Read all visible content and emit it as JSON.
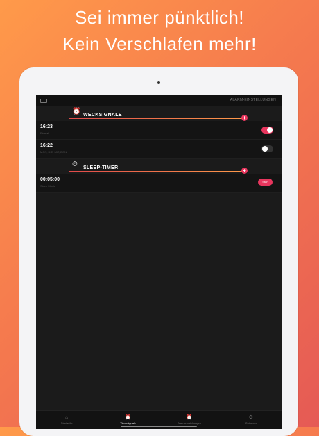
{
  "headline": {
    "line1": "Sei immer pünktlich!",
    "line2": "Kein Verschlafen mehr!"
  },
  "statusbar": {
    "settings_label": "ALARM-EINSTELLUNGEN"
  },
  "alarms_section": {
    "title": "WECKSIGNALE",
    "add_label": "+",
    "items": [
      {
        "time": "16:23",
        "sub": "Einmal",
        "enabled": true
      },
      {
        "time": "16:22",
        "sub": "MON, DIE, MIT, DON",
        "enabled": false
      }
    ]
  },
  "sleep_section": {
    "title": "SLEEP-TIMER",
    "add_label": "+",
    "items": [
      {
        "time": "00:05:00",
        "sub": "Sleep Music",
        "action": "Start"
      }
    ]
  },
  "tabs": [
    {
      "label": "Startseite",
      "icon": "home-icon"
    },
    {
      "label": "Wecksignale",
      "icon": "alarm-clock-icon",
      "active": true
    },
    {
      "label": "Alarmeinstellungen",
      "icon": "alarm-settings-icon"
    },
    {
      "label": "Optionen",
      "icon": "gear-icon"
    }
  ]
}
